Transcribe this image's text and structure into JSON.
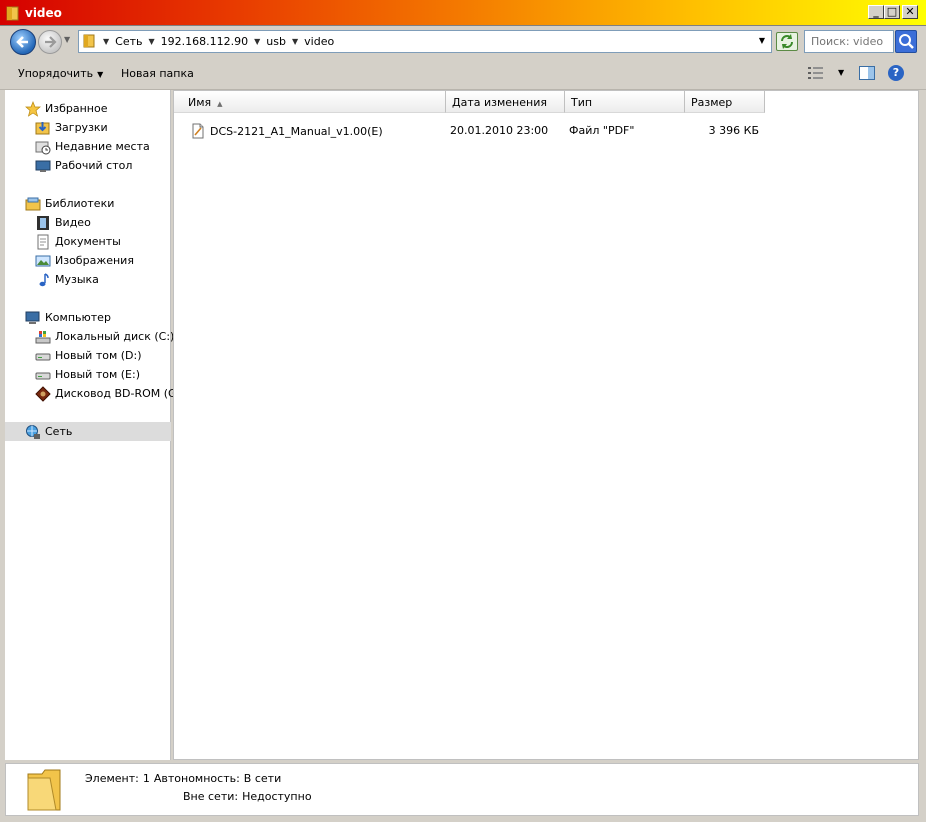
{
  "window": {
    "title": "video"
  },
  "window_controls": {
    "minimize": "_",
    "maximize": "□",
    "close": "✕"
  },
  "address": {
    "crumbs": [
      "Сеть",
      "192.168.112.90",
      "usb",
      "video"
    ]
  },
  "search": {
    "placeholder": "Поиск: video"
  },
  "toolbar": {
    "organize_label": "Упорядочить",
    "new_folder_label": "Новая папка",
    "help": "?"
  },
  "navpane": {
    "favorites": {
      "label": "Избранное",
      "items": [
        {
          "label": "Загрузки",
          "icon": "downloads-icon"
        },
        {
          "label": "Недавние места",
          "icon": "recent-places-icon"
        },
        {
          "label": "Рабочий стол",
          "icon": "desktop-icon"
        }
      ]
    },
    "libraries": {
      "label": "Библиотеки",
      "items": [
        {
          "label": "Видео",
          "icon": "video-library-icon"
        },
        {
          "label": "Документы",
          "icon": "documents-library-icon"
        },
        {
          "label": "Изображения",
          "icon": "pictures-library-icon"
        },
        {
          "label": "Музыка",
          "icon": "music-library-icon"
        }
      ]
    },
    "computer": {
      "label": "Компьютер",
      "items": [
        {
          "label": "Локальный диск (C:)",
          "icon": "system-drive-icon"
        },
        {
          "label": "Новый том (D:)",
          "icon": "drive-icon"
        },
        {
          "label": "Новый том (E:)",
          "icon": "drive-icon"
        },
        {
          "label": "Дисковод BD-ROM (G:)",
          "icon": "bd-rom-icon"
        }
      ]
    },
    "network": {
      "label": "Сеть"
    }
  },
  "filelist": {
    "columns": {
      "name": "Имя",
      "date": "Дата изменения",
      "type": "Тип",
      "size": "Размер"
    },
    "rows": [
      {
        "name": "DCS-2121_A1_Manual_v1.00(E)",
        "date": "20.01.2010 23:00",
        "type": "Файл \"PDF\"",
        "size": "3 396 КБ"
      }
    ]
  },
  "details": {
    "count_label": "Элемент:",
    "count": "1",
    "availability_label": "Автономность:",
    "availability": "В сети",
    "offline_label": "Вне сети:",
    "offline": "Недоступно"
  }
}
